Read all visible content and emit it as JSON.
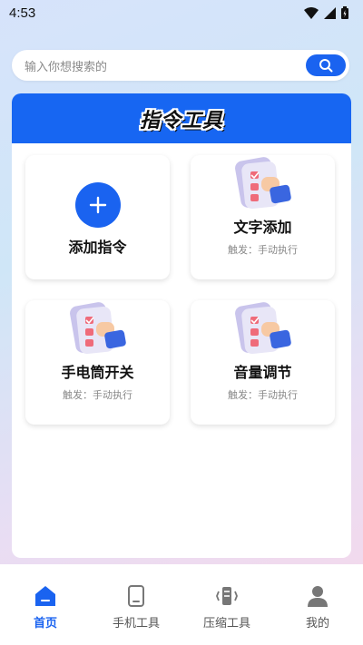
{
  "status_bar": {
    "time": "4:53"
  },
  "search": {
    "placeholder": "输入你想搜索的"
  },
  "panel": {
    "title": "指令工具"
  },
  "cards": [
    {
      "title": "添加指令",
      "subtitle": ""
    },
    {
      "title": "文字添加",
      "subtitle": "触发：手动执行"
    },
    {
      "title": "手电筒开关",
      "subtitle": "触发：手动执行"
    },
    {
      "title": "音量调节",
      "subtitle": "触发：手动执行"
    }
  ],
  "nav": [
    {
      "label": "首页",
      "icon": "home-icon",
      "active": true
    },
    {
      "label": "手机工具",
      "icon": "phone-icon",
      "active": false
    },
    {
      "label": "压缩工具",
      "icon": "compress-icon",
      "active": false
    },
    {
      "label": "我的",
      "icon": "profile-icon",
      "active": false
    }
  ],
  "colors": {
    "accent": "#1a63f0",
    "header_bg": "#1766f2"
  }
}
